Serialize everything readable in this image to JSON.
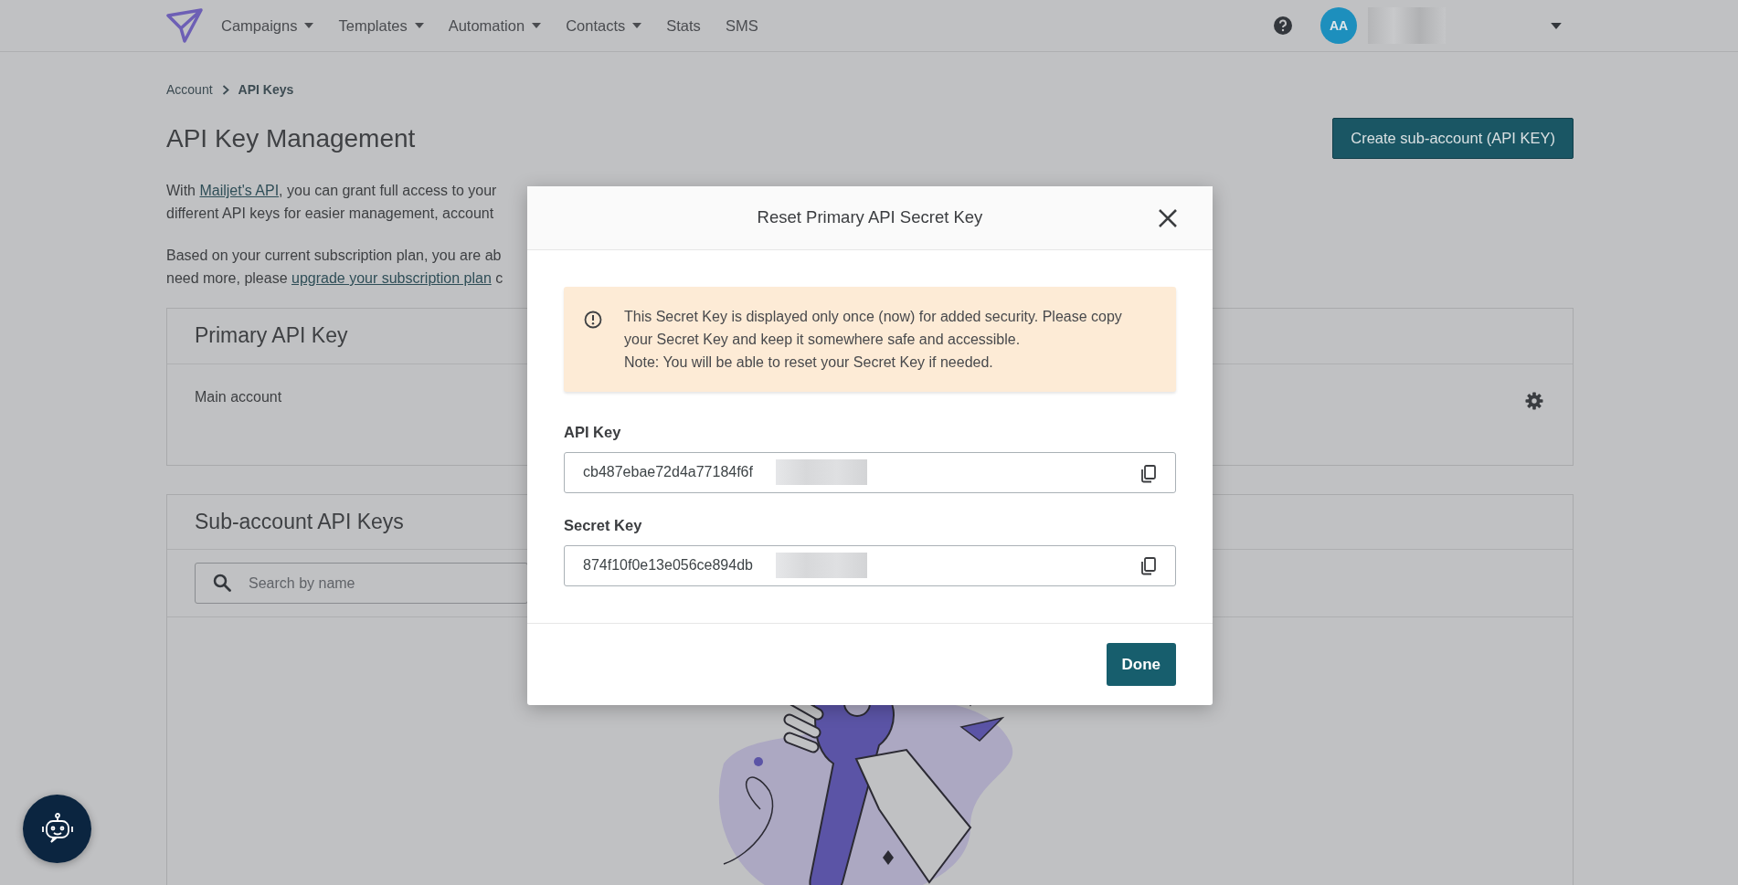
{
  "navbar": {
    "menu": [
      {
        "label": "Campaigns",
        "dropdown": true
      },
      {
        "label": "Templates",
        "dropdown": true
      },
      {
        "label": "Automation",
        "dropdown": true
      },
      {
        "label": "Contacts",
        "dropdown": true
      },
      {
        "label": "Stats",
        "dropdown": false
      },
      {
        "label": "SMS",
        "dropdown": false
      }
    ],
    "avatar": "AA"
  },
  "breadcrumb": [
    "Account",
    "API Keys"
  ],
  "page_title": "API Key Management",
  "create_button": "Create sub-account (API KEY)",
  "intro": [
    [
      {
        "text": "With "
      },
      {
        "text": "Mailjet's API",
        "link": true
      },
      {
        "text": ", you can grant full access to your"
      }
    ],
    [
      {
        "text": "different API keys for easier management, account"
      }
    ],
    [
      {
        "text": "Based on your current subscription plan, you are ab"
      }
    ],
    [
      {
        "text": "need more, please "
      },
      {
        "text": "upgrade your subscription plan",
        "link": true
      },
      {
        "text": " c"
      }
    ]
  ],
  "primary_card": {
    "title": "Primary API Key",
    "account": "Main account"
  },
  "subaccount_card": {
    "title": "Sub-account API Keys",
    "search": {
      "placeholder": "Search by name"
    }
  },
  "modal": {
    "title": "Reset Primary API Secret Key",
    "alert": [
      "This Secret Key is displayed only once (now) for added security. Please copy your Secret Key and keep it somewhere safe and accessible.",
      "Note: You will be able to reset your Secret Key if needed."
    ],
    "fields": [
      {
        "label": "API Key",
        "value": "cb487ebae72d4a77184f6f"
      },
      {
        "label": "Secret Key",
        "value": "874f10f0e13e056ce894db"
      }
    ],
    "done_button": "Done"
  }
}
